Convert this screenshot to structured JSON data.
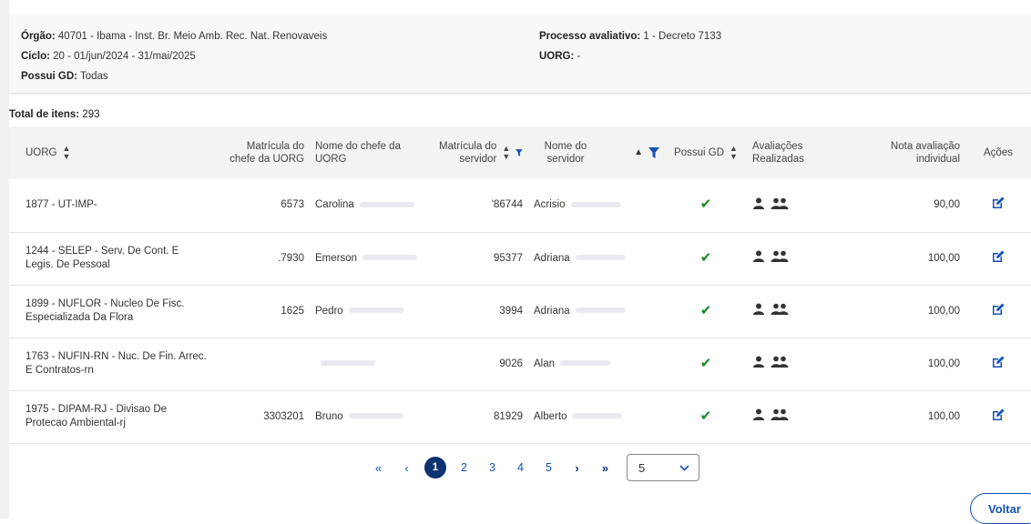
{
  "filters": {
    "orgao_label": "Órgão:",
    "orgao_value": " 40701 - Ibama - Inst. Br. Meio Amb. Rec. Nat. Renovaveis",
    "ciclo_label": "Ciclo:",
    "ciclo_value": " 20 - 01/jun/2024 - 31/mai/2025",
    "possui_label": "Possui GD:",
    "possui_value": " Todas",
    "processo_label": "Processo avaliativo:",
    "processo_value": " 1 - Decreto 7133",
    "uorg_label": "UORG:",
    "uorg_value": " -"
  },
  "total": {
    "label": "Total de itens:",
    "value": " 293"
  },
  "table": {
    "headers": {
      "uorg": "UORG",
      "matricula_chefe": "Matrícula do chefe da UORG",
      "nome_chefe": "Nome do chefe da UORG",
      "matricula_servidor": "Matrícula do servidor",
      "nome_servidor": "Nome do servidor",
      "possui_gd": "Possui GD",
      "avaliacoes": "Avaliações Realizadas",
      "nota": "Nota avaliação individual",
      "acoes": "Ações"
    },
    "rows": [
      {
        "uorg": "1877 - UT-IMP-",
        "mat_chefe": "6573",
        "nome_chefe": "Carolina",
        "mat_serv": "'86744",
        "nome_serv": "Acrisio",
        "nota": "90,00"
      },
      {
        "uorg": "1244 - SELEP - Serv. De Cont. E Legis. De Pessoal",
        "mat_chefe": ".7930",
        "nome_chefe": "Emerson",
        "mat_serv": "95377",
        "nome_serv": "Adriana",
        "nota": "100,00"
      },
      {
        "uorg": "1899 - NUFLOR - Nucleo De Fisc. Especializada Da Flora",
        "mat_chefe": "1625",
        "nome_chefe": "Pedro",
        "mat_serv": "3994",
        "nome_serv": "Adriana",
        "nota": "100,00"
      },
      {
        "uorg": "1763 - NUFIN-RN - Nuc. De Fin. Arrec. E Contratos-rn",
        "mat_chefe": "",
        "nome_chefe": "",
        "mat_serv": "9026",
        "nome_serv": "Alan",
        "nota": "100,00"
      },
      {
        "uorg": "1975 - DIPAM-RJ - Divisao De Protecao Ambiental-rj",
        "mat_chefe": "3303201",
        "nome_chefe": "Bruno",
        "mat_serv": "81929",
        "nome_serv": "Alberto",
        "nota": "100,00"
      }
    ]
  },
  "pagination": {
    "first": "«",
    "prev": "‹",
    "next": "›",
    "last": "»",
    "pages": [
      "1",
      "2",
      "3",
      "4",
      "5"
    ],
    "current": "1",
    "page_size": "5"
  },
  "back_button": "Voltar",
  "icons": {
    "sort": "sort-icon",
    "filter": "filter-icon",
    "check": "check-icon",
    "user": "user-icon",
    "users": "users-icon",
    "edit": "edit-icon"
  },
  "colors": {
    "primary": "#1351b4",
    "active_page": "#0c326f",
    "success": "#168821",
    "dark_icon": "#333333"
  }
}
